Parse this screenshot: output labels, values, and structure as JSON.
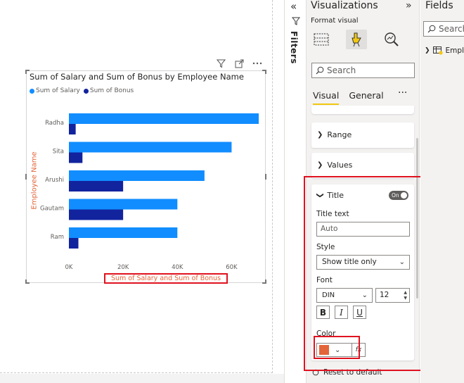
{
  "canvas": {
    "visual_header_icons": [
      "filter-icon",
      "focus-mode-icon",
      "more-options-icon"
    ]
  },
  "chart_data": {
    "type": "bar",
    "orientation": "horizontal",
    "title": "Sum of Salary and Sum of Bonus by Employee Name",
    "ylabel": "Employee Name",
    "xlabel": "Sum of Salary and Sum of Bonus",
    "categories": [
      "Radha",
      "Sita",
      "Arushi",
      "Gautam",
      "Ram"
    ],
    "series": [
      {
        "name": "Sum of Salary",
        "color": "#118dff",
        "values": [
          70000,
          60000,
          50000,
          40000,
          40000
        ]
      },
      {
        "name": "Sum of Bonus",
        "color": "#12239e",
        "values": [
          2500,
          5000,
          20000,
          20000,
          3500
        ]
      }
    ],
    "xlim": [
      0,
      70000
    ],
    "x_ticks": [
      "0K",
      "20K",
      "40K",
      "60K"
    ],
    "x_tick_values": [
      0,
      20000,
      40000,
      60000
    ],
    "legend_position": "top-left",
    "grid": false,
    "title_color": "#e3653a"
  },
  "filters": {
    "label": "Filters"
  },
  "visualizations": {
    "title": "Visualizations",
    "format_visual_label": "Format visual",
    "search_placeholder": "Search",
    "tabs": [
      "Visual",
      "General"
    ],
    "active_tab": "Visual",
    "more_label": "···",
    "sections": {
      "range": "Range",
      "values": "Values",
      "title": "Title"
    },
    "title_card": {
      "toggle_label": "On",
      "title_text_label": "Title text",
      "title_text_value": "Auto",
      "style_label": "Style",
      "style_value": "Show title only",
      "font_label": "Font",
      "font_value": "DIN",
      "font_size": "12",
      "bold_label": "B",
      "italic_label": "I",
      "underline_label": "U",
      "color_label": "Color",
      "color_value": "#e3653a",
      "fx_label": "fx"
    },
    "reset_label": "Reset to default"
  },
  "fields": {
    "title": "Fields",
    "search_placeholder": "Search",
    "table_name": "Employee"
  }
}
